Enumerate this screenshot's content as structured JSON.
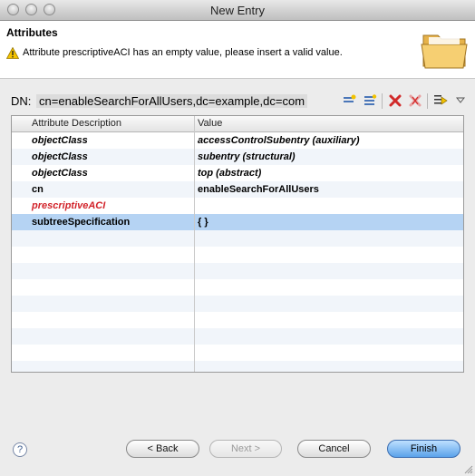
{
  "window": {
    "title": "New Entry"
  },
  "header": {
    "title": "Attributes",
    "message": "Attribute prescriptiveACI has an empty value, please insert a valid value."
  },
  "dn": {
    "label": "DN:",
    "value": "cn=enableSearchForAllUsers,dc=example,dc=com"
  },
  "table": {
    "headers": [
      "Attribute Description",
      "Value"
    ],
    "rows": [
      {
        "attr": "objectClass",
        "value": "accessControlSubentry (auxiliary)"
      },
      {
        "attr": "objectClass",
        "value": "subentry (structural)"
      },
      {
        "attr": "objectClass",
        "value": "top (abstract)"
      },
      {
        "attr": "cn",
        "value": "enableSearchForAllUsers"
      },
      {
        "attr": "prescriptiveACI",
        "value": ""
      },
      {
        "attr": "subtreeSpecification",
        "value": "{ }"
      }
    ]
  },
  "buttons": {
    "help": "?",
    "back": "< Back",
    "next": "Next >",
    "cancel": "Cancel",
    "finish": "Finish"
  },
  "icons": {
    "warning": "warning-icon",
    "folder": "folder-icon",
    "new_attribute": "new-attribute-icon",
    "new_value": "new-value-icon",
    "delete": "delete-icon",
    "delete_all": "delete-all-icon",
    "edit_options": "edit-options-icon",
    "menu": "dropdown-menu-icon"
  },
  "colors": {
    "selection": "#b5d3f3",
    "error_text": "#d2232a",
    "finish_button": "#5aa2ea"
  }
}
